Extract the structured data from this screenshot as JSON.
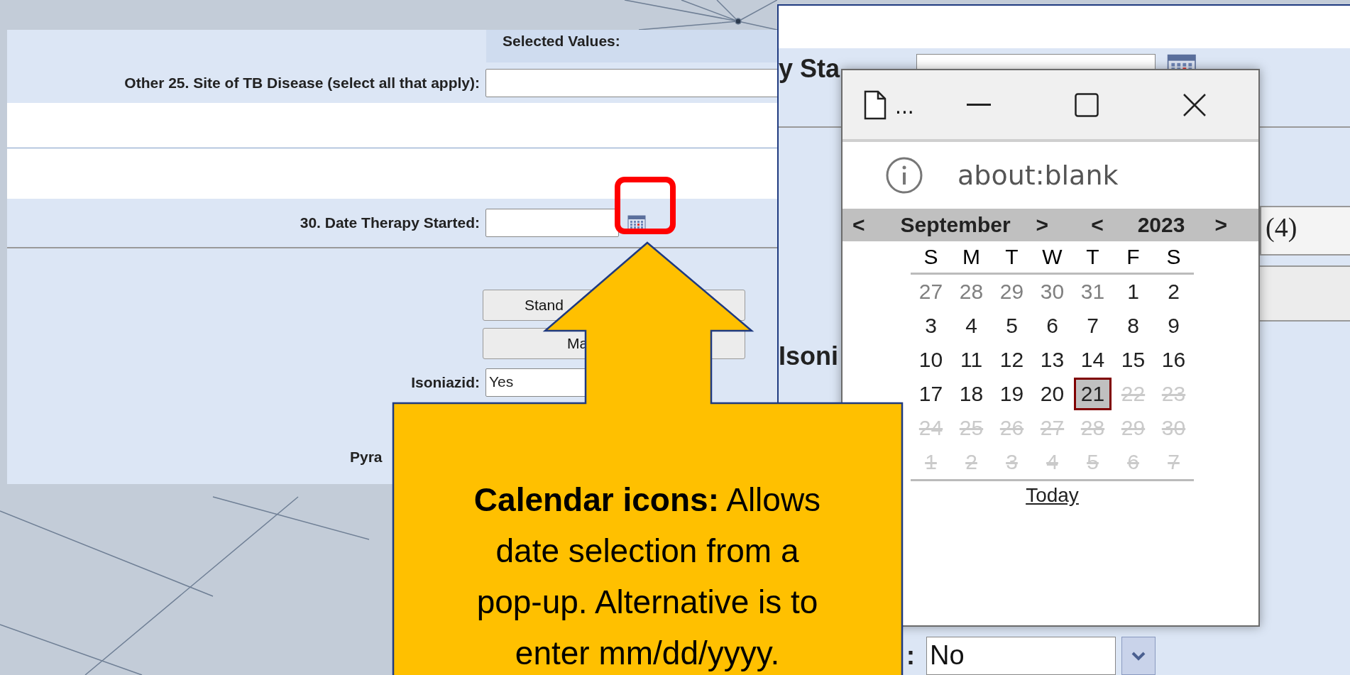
{
  "form_panel": {
    "selected_values_label": "Selected Values:",
    "rows": [
      {
        "kind": "text",
        "label": "Other 25. Site of TB Disease (select all that apply):"
      },
      {
        "kind": "date",
        "label": "30. Date Therapy Started:"
      }
    ],
    "buttons": [
      "Stand",
      "Ma"
    ],
    "fields": [
      {
        "kind": "field",
        "label": "Isoniazid:",
        "value": "Yes"
      },
      {
        "kind": "label",
        "label": "Pyra"
      }
    ]
  },
  "back_window": {
    "date_label": "y Sta",
    "count": "(4)",
    "drug_label": "Isoni",
    "select_label": ":",
    "select_value": "No"
  },
  "popup": {
    "title": "...",
    "address": "about:blank",
    "calendar": {
      "month_prev": "<",
      "month": "September",
      "month_next": ">",
      "year_prev": "<",
      "year": "2023",
      "year_next": ">",
      "weekdays": [
        "S",
        "M",
        "T",
        "W",
        "T",
        "F",
        "S"
      ],
      "weeks": [
        [
          {
            "day": "27",
            "kind": "other",
            "selected": false
          },
          {
            "day": "28",
            "kind": "other",
            "selected": false
          },
          {
            "day": "29",
            "kind": "other",
            "selected": false
          },
          {
            "day": "30",
            "kind": "other",
            "selected": false
          },
          {
            "day": "31",
            "kind": "other",
            "selected": false
          },
          {
            "day": "1",
            "kind": "day",
            "selected": false
          },
          {
            "day": "2",
            "kind": "day",
            "selected": false
          }
        ],
        [
          {
            "day": "3",
            "kind": "day",
            "selected": false
          },
          {
            "day": "4",
            "kind": "day",
            "selected": false
          },
          {
            "day": "5",
            "kind": "day",
            "selected": false
          },
          {
            "day": "6",
            "kind": "day",
            "selected": false
          },
          {
            "day": "7",
            "kind": "day",
            "selected": false
          },
          {
            "day": "8",
            "kind": "day",
            "selected": false
          },
          {
            "day": "9",
            "kind": "day",
            "selected": false
          }
        ],
        [
          {
            "day": "10",
            "kind": "day",
            "selected": false
          },
          {
            "day": "11",
            "kind": "day",
            "selected": false
          },
          {
            "day": "12",
            "kind": "day",
            "selected": false
          },
          {
            "day": "13",
            "kind": "day",
            "selected": false
          },
          {
            "day": "14",
            "kind": "day",
            "selected": false
          },
          {
            "day": "15",
            "kind": "day",
            "selected": false
          },
          {
            "day": "16",
            "kind": "day",
            "selected": false
          }
        ],
        [
          {
            "day": "17",
            "kind": "day",
            "selected": false
          },
          {
            "day": "18",
            "kind": "day",
            "selected": false
          },
          {
            "day": "19",
            "kind": "day",
            "selected": false
          },
          {
            "day": "20",
            "kind": "day",
            "selected": false
          },
          {
            "day": "21",
            "kind": "day",
            "selected": true
          },
          {
            "day": "22",
            "kind": "disabled",
            "selected": false
          },
          {
            "day": "23",
            "kind": "disabled",
            "selected": false
          }
        ],
        [
          {
            "day": "24",
            "kind": "disabled",
            "selected": false
          },
          {
            "day": "25",
            "kind": "disabled",
            "selected": false
          },
          {
            "day": "26",
            "kind": "disabled",
            "selected": false
          },
          {
            "day": "27",
            "kind": "disabled",
            "selected": false
          },
          {
            "day": "28",
            "kind": "disabled",
            "selected": false
          },
          {
            "day": "29",
            "kind": "disabled",
            "selected": false
          },
          {
            "day": "30",
            "kind": "disabled",
            "selected": false
          }
        ],
        [
          {
            "day": "1",
            "kind": "disabled",
            "selected": false
          },
          {
            "day": "2",
            "kind": "disabled",
            "selected": false
          },
          {
            "day": "3",
            "kind": "disabled",
            "selected": false
          },
          {
            "day": "4",
            "kind": "disabled",
            "selected": false
          },
          {
            "day": "5",
            "kind": "disabled",
            "selected": false
          },
          {
            "day": "6",
            "kind": "disabled",
            "selected": false
          },
          {
            "day": "7",
            "kind": "disabled",
            "selected": false
          }
        ]
      ],
      "today_link": "Today"
    }
  },
  "callout": {
    "text": "**Calendar icons:** Allows date selection from a pop-up. Alternative is to enter mm/dd/yyyy."
  }
}
